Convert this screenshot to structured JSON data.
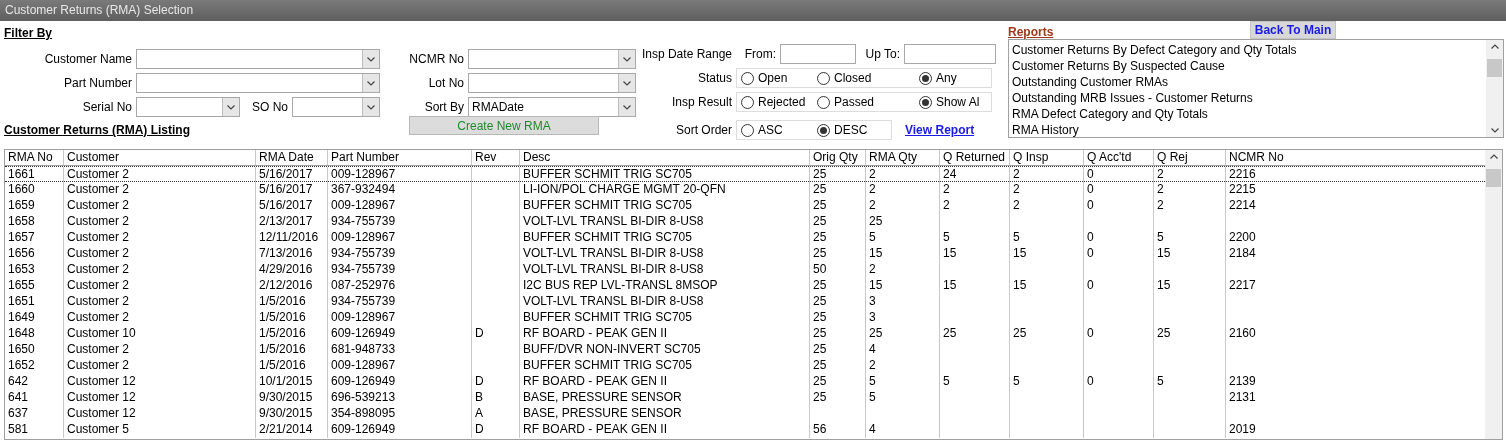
{
  "window": {
    "title": "Customer Returns (RMA) Selection"
  },
  "filter": {
    "heading": "Filter By",
    "customer_name": {
      "label": "Customer Name"
    },
    "part_number": {
      "label": "Part Number"
    },
    "serial_no": {
      "label": "Serial No"
    },
    "so_no": {
      "label": "SO No"
    },
    "ncmr_no": {
      "label": "NCMR No"
    },
    "lot_no": {
      "label": "Lot No"
    },
    "sort_by": {
      "label": "Sort By",
      "value": "RMADate"
    },
    "create_button": "Create New RMA"
  },
  "inspection": {
    "date_range_label": "Insp Date Range",
    "from_label": "From:",
    "to_label": "Up To:",
    "radio_groups": [
      {
        "label": "Status",
        "options": [
          {
            "label": "Open",
            "selected": false
          },
          {
            "label": "Closed",
            "selected": false
          },
          {
            "label": "Any",
            "selected": true
          }
        ]
      },
      {
        "label": "Insp Result",
        "options": [
          {
            "label": "Rejected",
            "selected": false
          },
          {
            "label": "Passed",
            "selected": false
          },
          {
            "label": "Show Al",
            "selected": true
          }
        ]
      },
      {
        "label": "Sort Order",
        "options": [
          {
            "label": "ASC",
            "selected": false
          },
          {
            "label": "DESC",
            "selected": true
          }
        ]
      }
    ],
    "view_report_link": "View Report"
  },
  "reports": {
    "heading": "Reports",
    "back_button": "Back To Main",
    "items": [
      "Customer Returns By Defect Category and Qty Totals",
      "Customer Returns By Suspected Cause",
      "Outstanding Customer RMAs",
      "Outstanding MRB Issues - Customer Returns",
      "RMA Defect Category and Qty Totals",
      "RMA History"
    ]
  },
  "listing": {
    "heading": "Customer Returns (RMA) Listing",
    "columns": [
      "RMA No",
      "Customer",
      "RMA Date",
      "Part Number",
      "Rev",
      "Desc",
      "Orig Qty",
      "RMA Qty",
      "Q Returned",
      "Q Insp",
      "Q Acc'td",
      "Q Rej",
      "NCMR No"
    ],
    "rows": [
      {
        "selected": true,
        "cells": [
          "1661",
          "Customer 2",
          "5/16/2017",
          "009-128967",
          null,
          "BUFFER SCHMIT TRIG SC705",
          "25",
          "2",
          "24",
          "2",
          "0",
          "2",
          "2216"
        ]
      },
      {
        "selected": false,
        "cells": [
          "1660",
          "Customer 2",
          "5/16/2017",
          "367-932494",
          null,
          "LI-ION/POL CHARGE MGMT 20-QFN",
          "25",
          "2",
          "2",
          "2",
          "0",
          "2",
          "2215"
        ]
      },
      {
        "selected": false,
        "cells": [
          "1659",
          "Customer 2",
          "5/16/2017",
          "009-128967",
          null,
          "BUFFER SCHMIT TRIG SC705",
          "25",
          "2",
          "2",
          "2",
          "0",
          "2",
          "2214"
        ]
      },
      {
        "selected": false,
        "cells": [
          "1658",
          "Customer 2",
          "2/13/2017",
          "934-755739",
          null,
          "VOLT-LVL TRANSL BI-DIR 8-US8",
          "25",
          "25",
          null,
          null,
          null,
          null,
          null
        ]
      },
      {
        "selected": false,
        "cells": [
          "1657",
          "Customer 2",
          "12/11/2016",
          "009-128967",
          null,
          "BUFFER SCHMIT TRIG SC705",
          "25",
          "5",
          "5",
          "5",
          "0",
          "5",
          "2200"
        ]
      },
      {
        "selected": false,
        "cells": [
          "1656",
          "Customer 2",
          "7/13/2016",
          "934-755739",
          null,
          "VOLT-LVL TRANSL BI-DIR 8-US8",
          "25",
          "15",
          "15",
          "15",
          "0",
          "15",
          "2184"
        ]
      },
      {
        "selected": false,
        "cells": [
          "1653",
          "Customer 2",
          "4/29/2016",
          "934-755739",
          null,
          "VOLT-LVL TRANSL BI-DIR 8-US8",
          "50",
          "2",
          null,
          null,
          null,
          null,
          null
        ]
      },
      {
        "selected": false,
        "cells": [
          "1655",
          "Customer 2",
          "2/12/2016",
          "087-252976",
          null,
          "I2C BUS REP LVL-TRANSL 8MSOP",
          "25",
          "15",
          "15",
          "15",
          "0",
          "15",
          "2217"
        ]
      },
      {
        "selected": false,
        "cells": [
          "1651",
          "Customer 2",
          "1/5/2016",
          "934-755739",
          null,
          "VOLT-LVL TRANSL BI-DIR 8-US8",
          "25",
          "3",
          null,
          null,
          null,
          null,
          null
        ]
      },
      {
        "selected": false,
        "cells": [
          "1649",
          "Customer 2",
          "1/5/2016",
          "009-128967",
          null,
          "BUFFER SCHMIT TRIG SC705",
          "25",
          "3",
          null,
          null,
          null,
          null,
          null
        ]
      },
      {
        "selected": false,
        "cells": [
          "1648",
          "Customer 10",
          "1/5/2016",
          "609-126949",
          "D",
          "RF BOARD - PEAK GEN II",
          "25",
          "25",
          "25",
          "25",
          "0",
          "25",
          "2160"
        ]
      },
      {
        "selected": false,
        "cells": [
          "1650",
          "Customer 2",
          "1/5/2016",
          "681-948733",
          null,
          "BUFF/DVR NON-INVERT SC705",
          "25",
          "4",
          null,
          null,
          null,
          null,
          null
        ]
      },
      {
        "selected": false,
        "cells": [
          "1652",
          "Customer 2",
          "1/5/2016",
          "009-128967",
          null,
          "BUFFER SCHMIT TRIG SC705",
          "25",
          "2",
          null,
          null,
          null,
          null,
          null
        ]
      },
      {
        "selected": false,
        "cells": [
          "642",
          "Customer 12",
          "10/1/2015",
          "609-126949",
          "D",
          "RF BOARD - PEAK GEN II",
          "25",
          "5",
          "5",
          "5",
          "0",
          "5",
          "2139"
        ]
      },
      {
        "selected": false,
        "cells": [
          "641",
          "Customer 12",
          "9/30/2015",
          "696-539213",
          "B",
          "BASE, PRESSURE SENSOR",
          "25",
          "5",
          null,
          null,
          null,
          null,
          "2131"
        ]
      },
      {
        "selected": false,
        "cells": [
          "637",
          "Customer 12",
          "9/30/2015",
          "354-898095",
          "A",
          "BASE, PRESSURE SENSOR",
          null,
          null,
          null,
          null,
          null,
          null,
          null
        ]
      },
      {
        "selected": false,
        "cells": [
          "581",
          "Customer 5",
          "2/21/2014",
          "609-126949",
          "D",
          "RF BOARD - PEAK GEN II",
          "56",
          "4",
          null,
          null,
          null,
          null,
          "2019"
        ]
      }
    ]
  }
}
